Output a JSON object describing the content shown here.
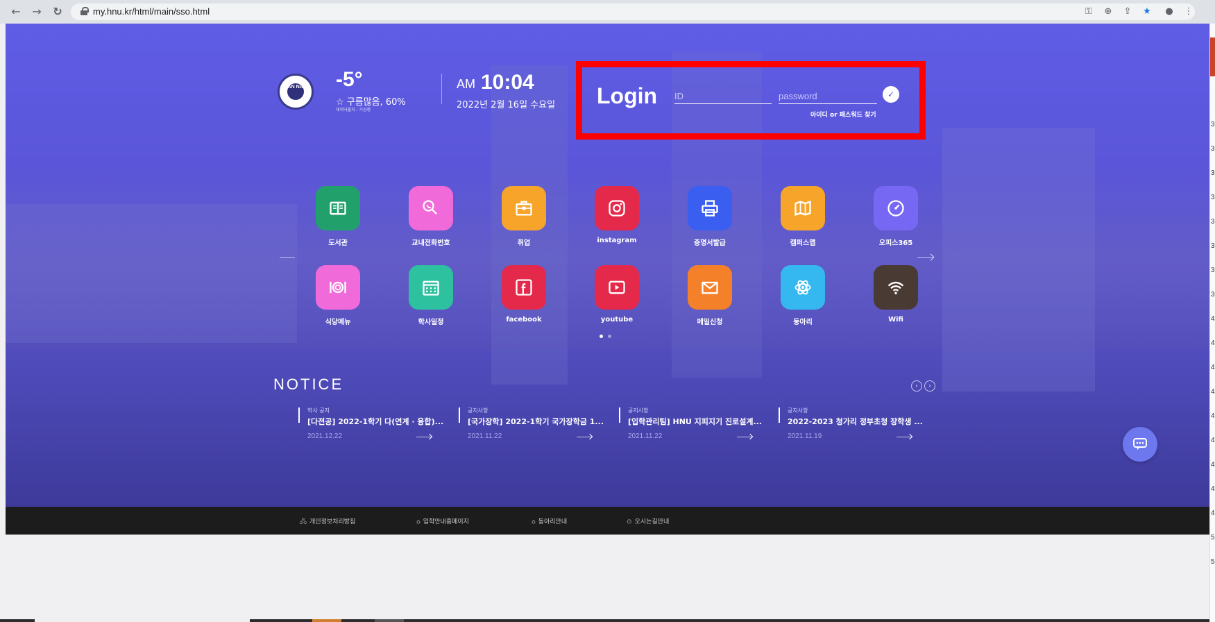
{
  "browser": {
    "url": "my.hnu.kr/html/main/sso.html"
  },
  "weather": {
    "temperature": "-5°",
    "description": "☆ 구름많음, 60%",
    "source": "데이터출처 : 기상청"
  },
  "logo": {
    "text": "HAN NAM"
  },
  "clock": {
    "ampm": "AM",
    "time": "10:04",
    "date": "2022년 2월 16일 수요일"
  },
  "login": {
    "title": "Login",
    "id_placeholder": "ID",
    "password_placeholder": "password",
    "find_link": "아이디 or 패스워드 찾기",
    "box_color": "#ff0000"
  },
  "apps": [
    {
      "label": "도서관",
      "icon": "book-icon",
      "color": "#22a06b"
    },
    {
      "label": "교내전화번호",
      "icon": "phone-icon",
      "color": "#f06bd9"
    },
    {
      "label": "취업",
      "icon": "briefcase-icon",
      "color": "#f7a52a"
    },
    {
      "label": "instagram",
      "icon": "instagram-icon",
      "color": "#e5294a"
    },
    {
      "label": "증명서발급",
      "icon": "printer-icon",
      "color": "#3a5ef0"
    },
    {
      "label": "캠퍼스맵",
      "icon": "map-icon",
      "color": "#f7a52a"
    },
    {
      "label": "오피스365",
      "icon": "speedometer-icon",
      "color": "#7668f2"
    },
    {
      "label": "식당메뉴",
      "icon": "dining-icon",
      "color": "#f06bd9"
    },
    {
      "label": "학사일정",
      "icon": "calendar-icon",
      "color": "#2dc1a0"
    },
    {
      "label": "facebook",
      "icon": "facebook-icon",
      "color": "#e5294a"
    },
    {
      "label": "youtube",
      "icon": "youtube-icon",
      "color": "#e5294a"
    },
    {
      "label": "메일신청",
      "icon": "mail-icon",
      "color": "#f5802a"
    },
    {
      "label": "동아리",
      "icon": "atom-icon",
      "color": "#35b8f0"
    },
    {
      "label": "Wifi",
      "icon": "wifi-icon",
      "color": "#4a3a34"
    }
  ],
  "notice": {
    "title": "NOTICE",
    "items": [
      {
        "category": "학사 공지",
        "title": "[다전공] 2022-1학기 다(연계 · 융합)...",
        "date": "2021.12.22"
      },
      {
        "category": "공지사항",
        "title": "[국가장학] 2022-1학기 국가장학금 1...",
        "date": "2021.11.22"
      },
      {
        "category": "공지사항",
        "title": "[입학관리팀] HNU 지피지기 진로설계...",
        "date": "2021.11.22"
      },
      {
        "category": "공지사항",
        "title": "2022-2023 청가리 정부초청 장학생 ...",
        "date": "2021.11.19"
      }
    ]
  },
  "footer": {
    "links": [
      {
        "icon": "🖧",
        "label": "개인정보처리방침"
      },
      {
        "icon": "⌂",
        "label": "입학안내홈페이지"
      },
      {
        "icon": "⌂",
        "label": "동아리안내"
      },
      {
        "icon": "⊙",
        "label": "오시는길안내"
      }
    ]
  },
  "edge_numbers": [
    "3",
    "3",
    "3",
    "3",
    "3",
    "3",
    "3",
    "3",
    "4",
    "4",
    "4",
    "4",
    "4",
    "4",
    "4",
    "4",
    "4",
    "5",
    "5"
  ]
}
